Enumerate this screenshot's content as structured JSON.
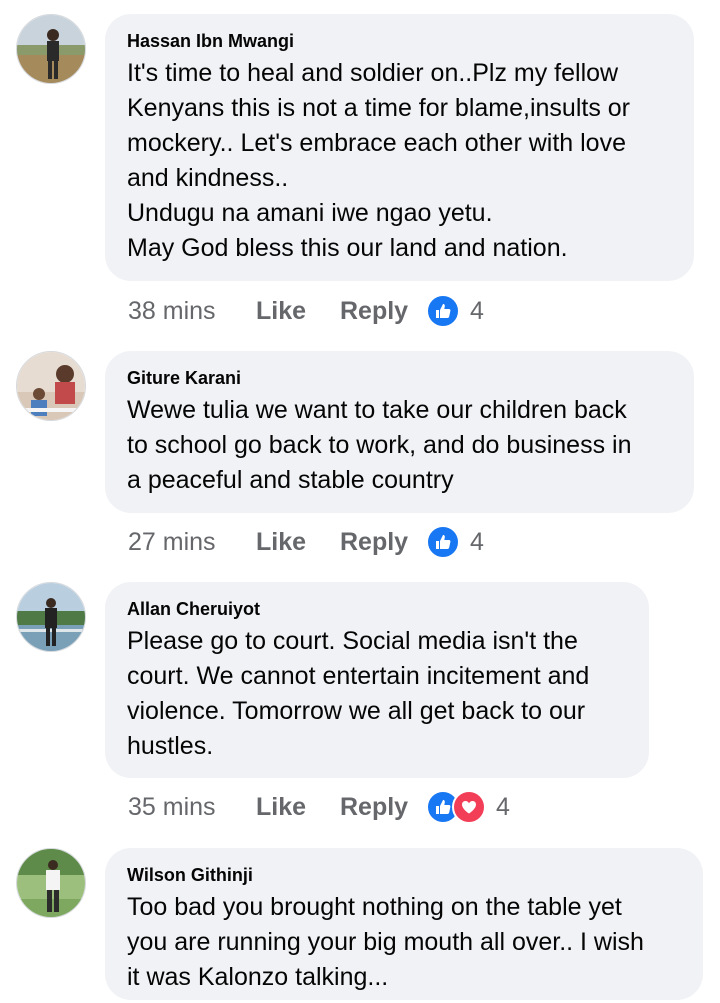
{
  "comments": [
    {
      "author": "Hassan Ibn Mwangi",
      "text": "It's time to heal and soldier on..Plz my fellow\nKenyans this is not a time for blame,insults or\nmockery.. Let's embrace each other with love\nand kindness..\nUndugu na amani iwe ngao yetu.\nMay God bless this our land and nation.",
      "time": "38 mins",
      "like_label": "Like",
      "reply_label": "Reply",
      "reaction_count": "4",
      "reactions": [
        "like"
      ]
    },
    {
      "author": "Giture Karani",
      "text": "Wewe tulia we want to take our children back\nto school go back to work, and do business in\na peaceful and stable country",
      "time": "27 mins",
      "like_label": "Like",
      "reply_label": "Reply",
      "reaction_count": "4",
      "reactions": [
        "like"
      ]
    },
    {
      "author": "Allan Cheruiyot",
      "text": "Please go to court. Social media isn't the\ncourt. We cannot entertain incitement and\nviolence. Tomorrow we all get back to our\nhustles.",
      "time": "35 mins",
      "like_label": "Like",
      "reply_label": "Reply",
      "reaction_count": "4",
      "reactions": [
        "like",
        "love"
      ]
    },
    {
      "author": "Wilson Githinji",
      "text": "Too bad you brought nothing on the table yet\nyou are running your big mouth all over.. I wish\nit was Kalonzo talking...",
      "time": "",
      "like_label": "",
      "reply_label": "",
      "reaction_count": "",
      "reactions": []
    }
  ],
  "colors": {
    "bubble_bg": "#f0f2f5",
    "meta_text": "#65676b",
    "like_blue": "#1877f2",
    "love_red": "#f33e58"
  }
}
